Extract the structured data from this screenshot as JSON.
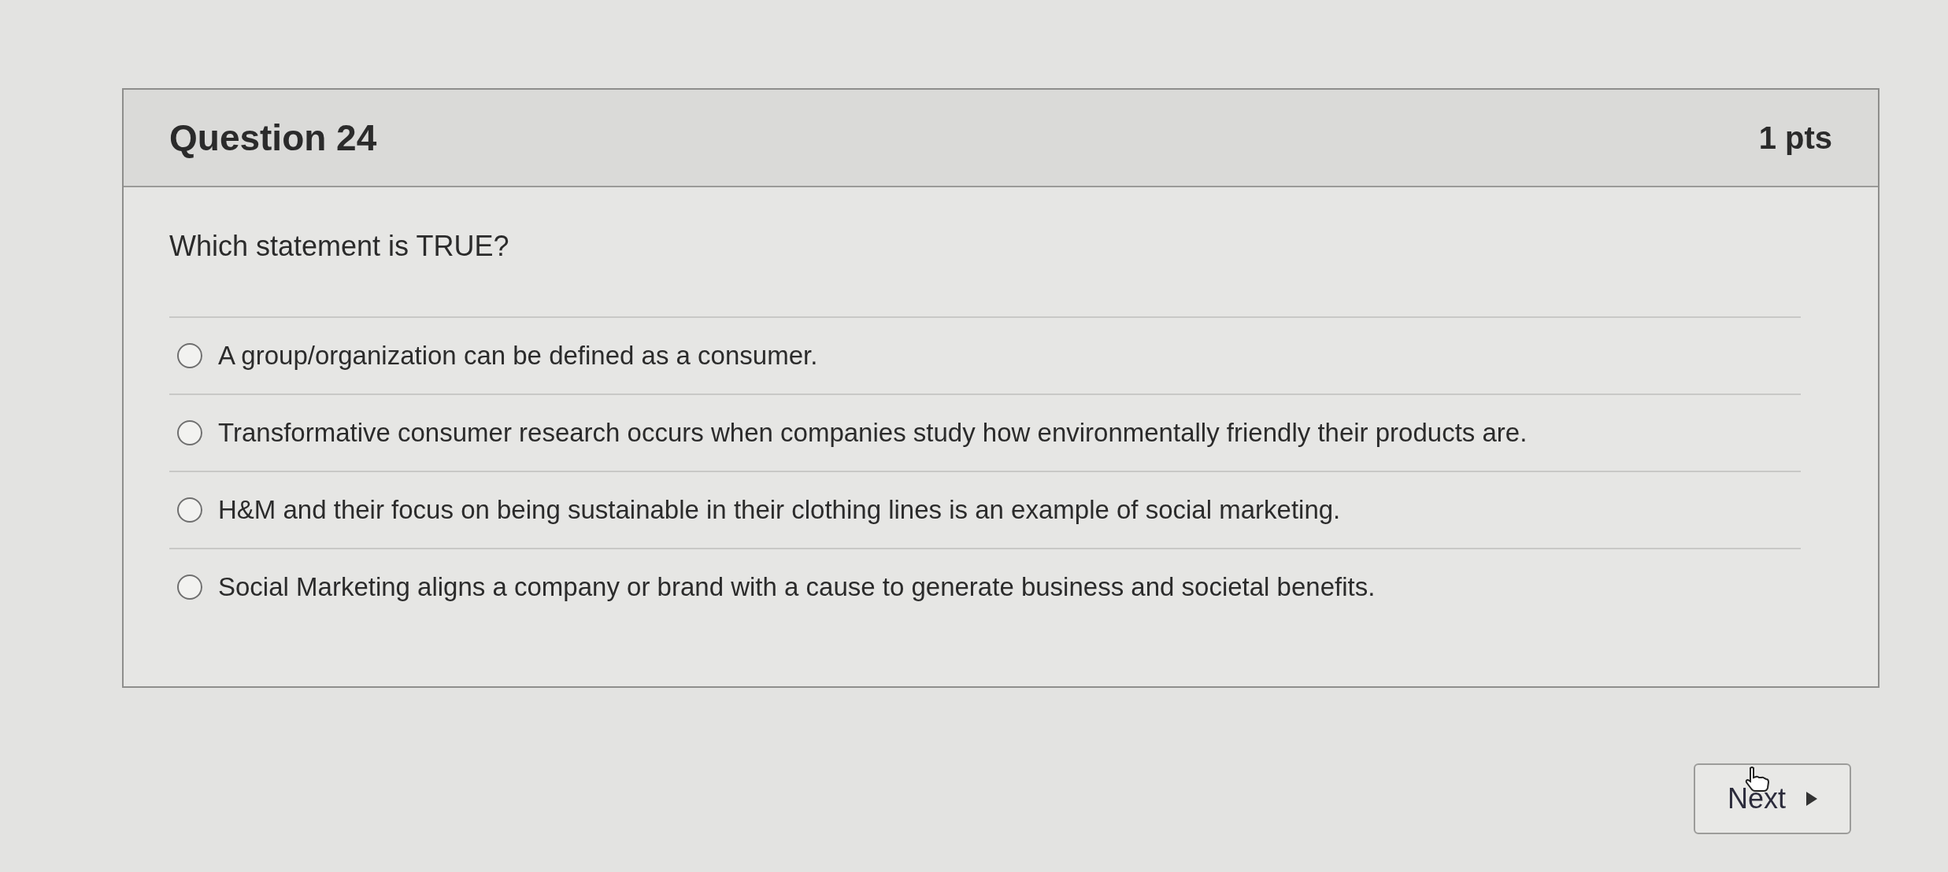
{
  "question": {
    "title": "Question 24",
    "points": "1 pts",
    "prompt": "Which statement is TRUE?",
    "answers": [
      {
        "text": "A group/organization can be defined as a consumer.",
        "selected": false
      },
      {
        "text": "Transformative consumer research occurs when companies study how environmentally friendly their products are.",
        "selected": false
      },
      {
        "text": "H&M and their focus on being sustainable in their clothing lines is an example of social marketing.",
        "selected": false
      },
      {
        "text": "Social Marketing aligns a company or brand with a cause to generate business and societal benefits.",
        "selected": false
      }
    ]
  },
  "next_button": {
    "label": "Next"
  }
}
